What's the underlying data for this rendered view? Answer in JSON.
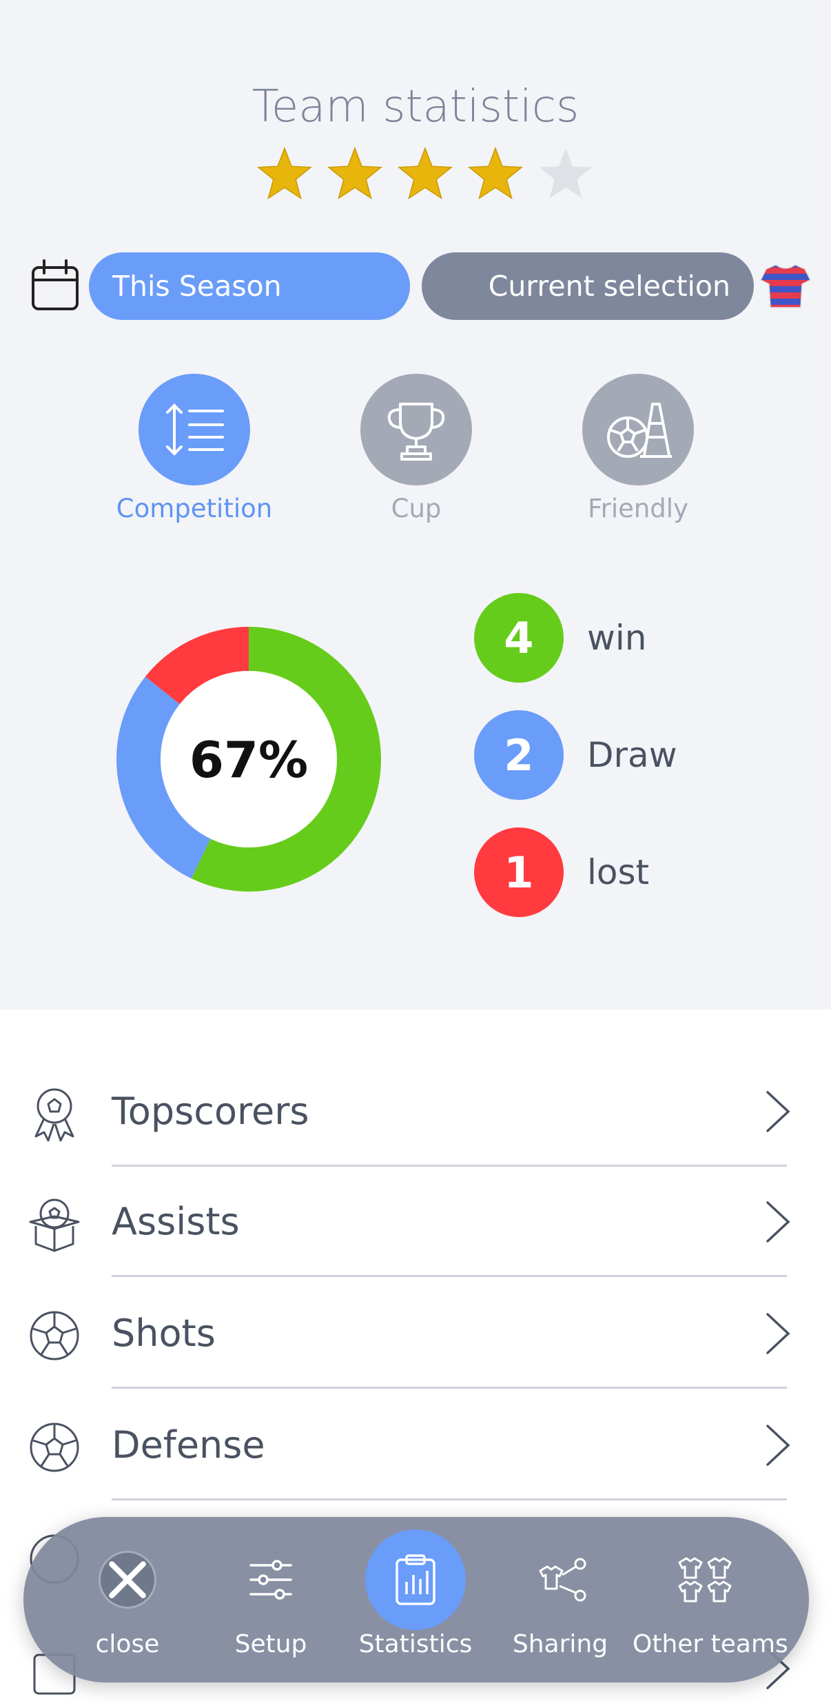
{
  "header": {
    "title": "Team statistics"
  },
  "rating": {
    "stars_filled": 4,
    "stars_total": 5
  },
  "filters": {
    "season_label": "This Season",
    "selection_label": "Current selection"
  },
  "categories": [
    {
      "label": "Competition",
      "icon": "list-sort-icon",
      "active": true
    },
    {
      "label": "Cup",
      "icon": "trophy-icon",
      "active": false
    },
    {
      "label": "Friendly",
      "icon": "ball-cone-icon",
      "active": false
    }
  ],
  "summary": {
    "percent_label": "67%",
    "win": {
      "count": "4",
      "label": "win",
      "color": "#66cc1b"
    },
    "draw": {
      "count": "2",
      "label": "Draw",
      "color": "#6a9cf9"
    },
    "lost": {
      "count": "1",
      "label": "lost",
      "color": "#ff3b3f"
    }
  },
  "chart_data": {
    "type": "pie",
    "categories": [
      "win",
      "Draw",
      "lost"
    ],
    "values": [
      4,
      2,
      1
    ],
    "colors": [
      "#66cc1b",
      "#6a9cf9",
      "#ff3b3f"
    ],
    "center_label": "67%"
  },
  "stats_list": [
    {
      "label": "Topscorers",
      "icon": "medal-ball-icon"
    },
    {
      "label": "Assists",
      "icon": "box-ball-icon"
    },
    {
      "label": "Shots",
      "icon": "ball-icon"
    },
    {
      "label": "Defense",
      "icon": "ball-icon"
    }
  ],
  "dock": [
    {
      "label": "close",
      "icon": "close-icon"
    },
    {
      "label": "Setup",
      "icon": "sliders-icon"
    },
    {
      "label": "Statistics",
      "icon": "clipboard-chart-icon",
      "active": true
    },
    {
      "label": "Sharing",
      "icon": "share-shirt-icon"
    },
    {
      "label": "Other teams",
      "icon": "shirts-icon"
    }
  ]
}
